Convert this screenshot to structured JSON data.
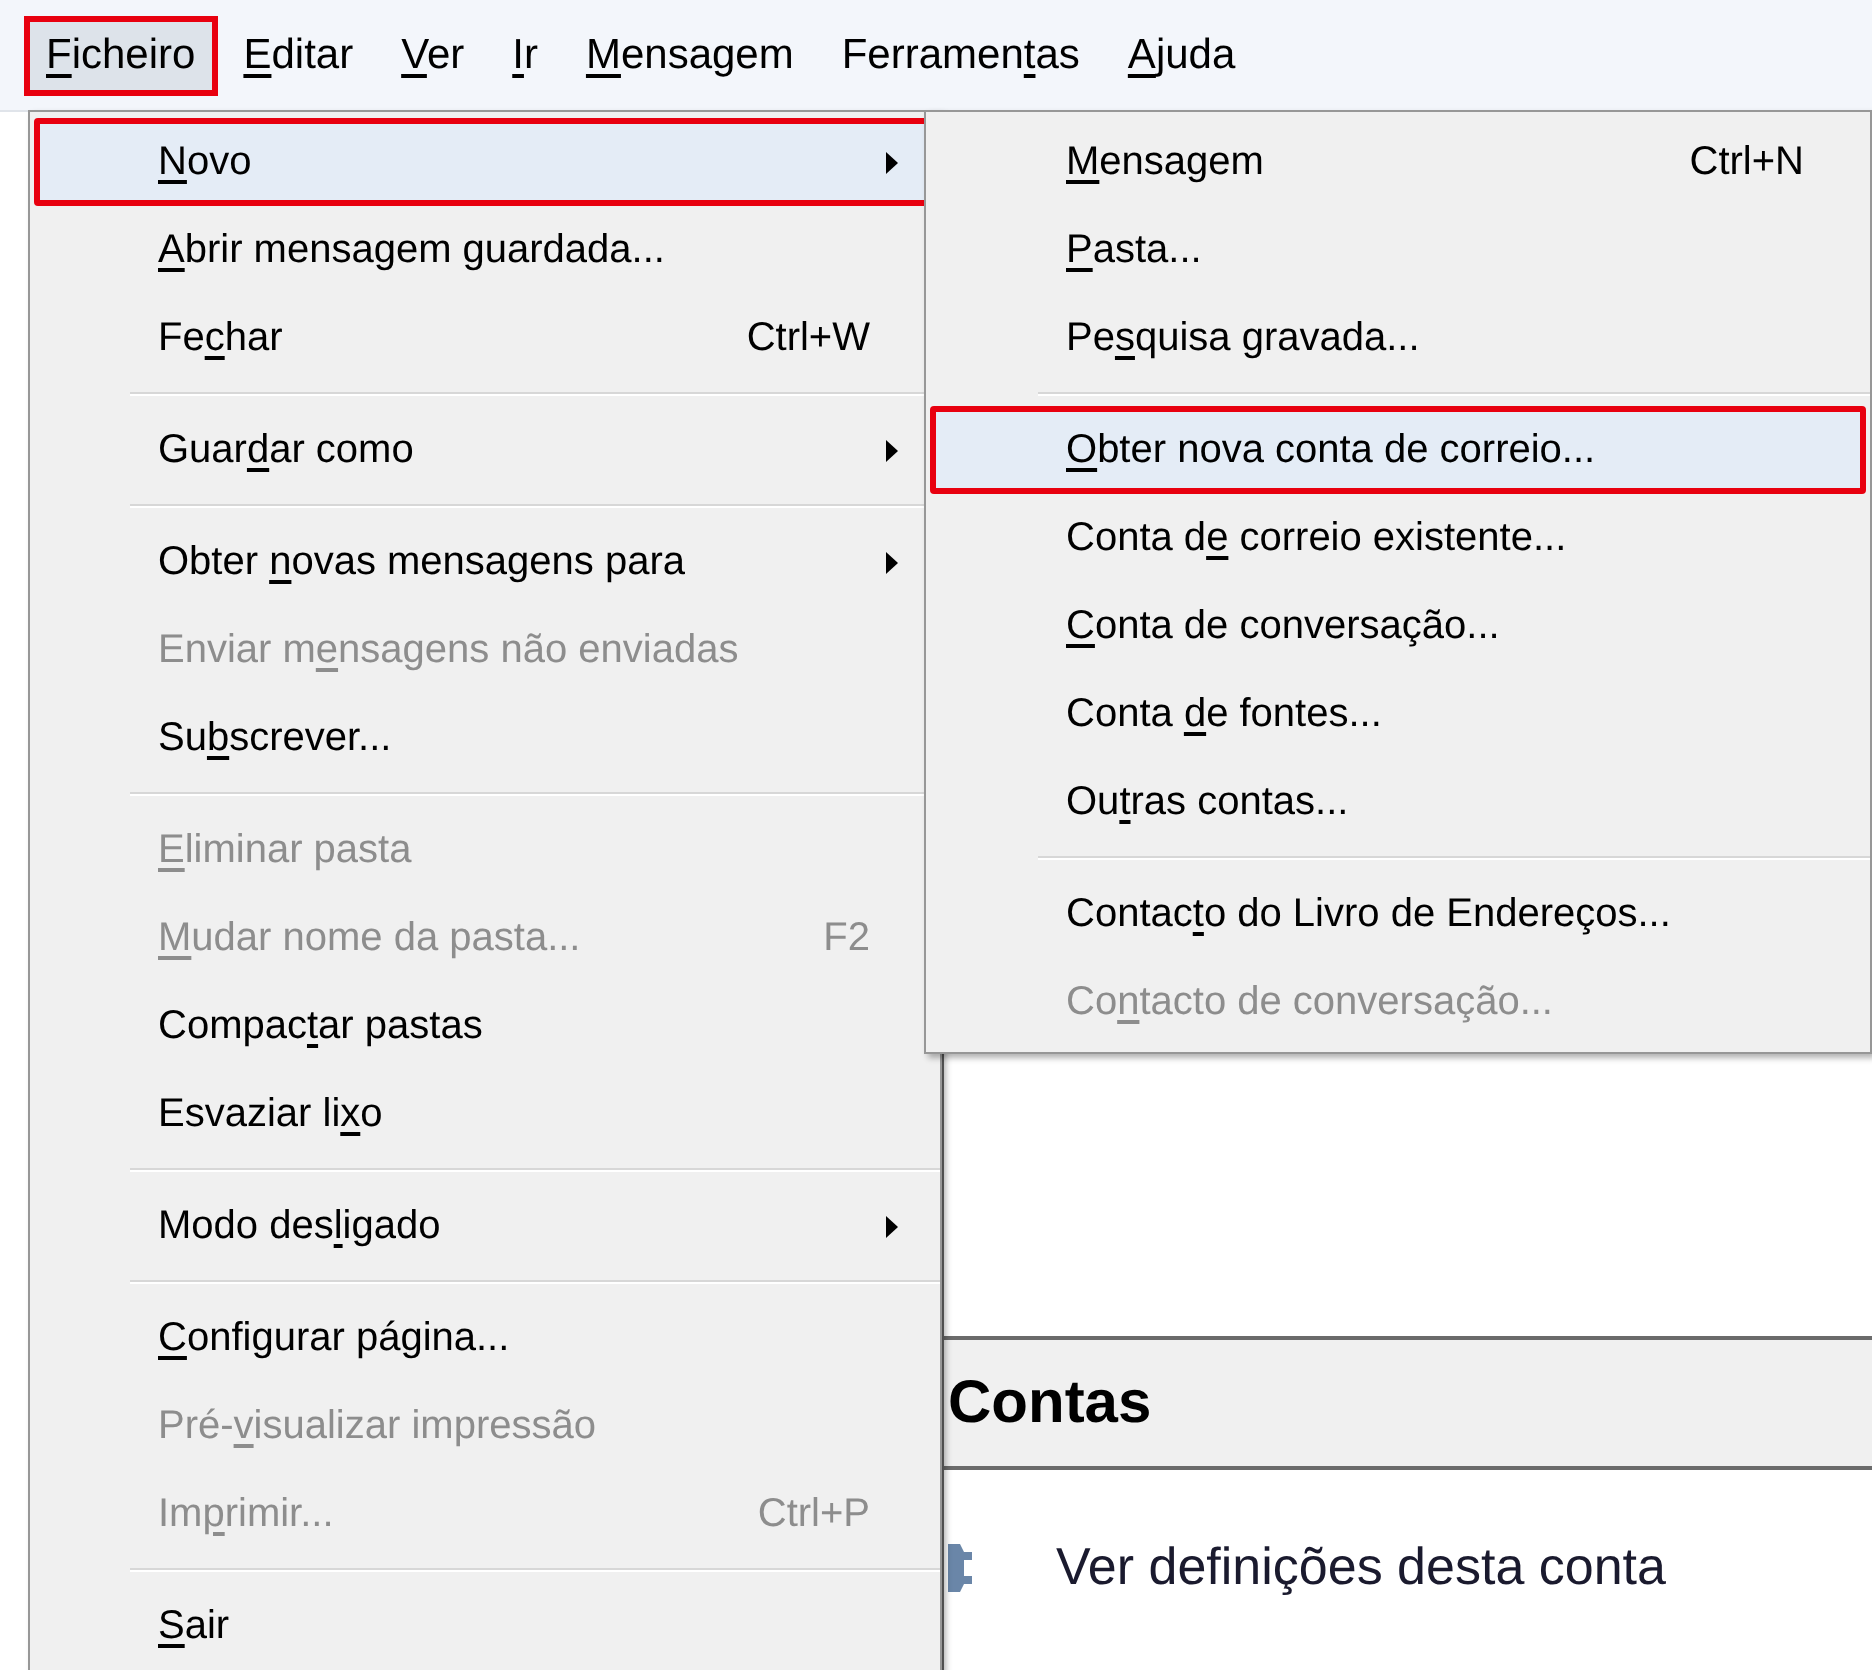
{
  "menu_bar": [
    {
      "label": {
        "key": "F",
        "post": "icheiro"
      },
      "selected": true,
      "highlighted": true
    },
    {
      "label": {
        "key": "E",
        "post": "ditar"
      },
      "selected": false,
      "highlighted": false
    },
    {
      "label": {
        "key": "V",
        "post": "er"
      },
      "selected": false,
      "highlighted": false
    },
    {
      "label": {
        "key": "I",
        "post": "r"
      },
      "selected": false,
      "highlighted": false
    },
    {
      "label": {
        "key": "M",
        "post": "ensagem"
      },
      "selected": false,
      "highlighted": false
    },
    {
      "label": {
        "pre": "Ferramen",
        "key": "t",
        "post": "as"
      },
      "selected": false,
      "highlighted": false
    },
    {
      "label": {
        "key": "A",
        "post": "juda"
      },
      "selected": false,
      "highlighted": false
    }
  ],
  "file_menu": [
    {
      "kind": "item",
      "label": {
        "key": "N",
        "post": "ovo"
      },
      "submenu": true,
      "disabled": false,
      "selected": true,
      "highlighted": true
    },
    {
      "kind": "item",
      "label": {
        "key": "A",
        "post": "brir mensagem guardada..."
      },
      "submenu": false,
      "disabled": false,
      "selected": false,
      "highlighted": false
    },
    {
      "kind": "item",
      "label": {
        "pre": "Fe",
        "key": "c",
        "post": "har"
      },
      "shortcut": "Ctrl+W",
      "submenu": false,
      "disabled": false,
      "selected": false,
      "highlighted": false
    },
    {
      "kind": "separator"
    },
    {
      "kind": "item",
      "label": {
        "pre": "Guar",
        "key": "d",
        "post": "ar como"
      },
      "submenu": true,
      "disabled": false,
      "selected": false,
      "highlighted": false
    },
    {
      "kind": "separator"
    },
    {
      "kind": "item",
      "label": {
        "pre": "Obter ",
        "key": "n",
        "post": "ovas mensagens para"
      },
      "submenu": true,
      "disabled": false,
      "selected": false,
      "highlighted": false
    },
    {
      "kind": "item",
      "label": {
        "pre": "Enviar m",
        "key": "e",
        "post": "nsagens não enviadas"
      },
      "submenu": false,
      "disabled": true,
      "selected": false,
      "highlighted": false
    },
    {
      "kind": "item",
      "label": {
        "pre": "Su",
        "key": "b",
        "post": "screver..."
      },
      "submenu": false,
      "disabled": false,
      "selected": false,
      "highlighted": false
    },
    {
      "kind": "separator"
    },
    {
      "kind": "item",
      "label": {
        "key": "E",
        "post": "liminar pasta"
      },
      "submenu": false,
      "disabled": true,
      "selected": false,
      "highlighted": false
    },
    {
      "kind": "item",
      "label": {
        "key": "M",
        "post": "udar nome da pasta..."
      },
      "shortcut": "F2",
      "submenu": false,
      "disabled": true,
      "selected": false,
      "highlighted": false
    },
    {
      "kind": "item",
      "label": {
        "pre": "Compac",
        "key": "t",
        "post": "ar pastas"
      },
      "submenu": false,
      "disabled": false,
      "selected": false,
      "highlighted": false
    },
    {
      "kind": "item",
      "label": {
        "pre": "Esvaziar li",
        "key": "x",
        "post": "o"
      },
      "submenu": false,
      "disabled": false,
      "selected": false,
      "highlighted": false
    },
    {
      "kind": "separator"
    },
    {
      "kind": "item",
      "label": {
        "pre": "Modo des",
        "key": "l",
        "post": "igado"
      },
      "submenu": true,
      "disabled": false,
      "selected": false,
      "highlighted": false
    },
    {
      "kind": "separator"
    },
    {
      "kind": "item",
      "label": {
        "key": "C",
        "post": "onfigurar página..."
      },
      "submenu": false,
      "disabled": false,
      "selected": false,
      "highlighted": false
    },
    {
      "kind": "item",
      "label": {
        "pre": "Pré-",
        "key": "v",
        "post": "isualizar impressão"
      },
      "submenu": false,
      "disabled": true,
      "selected": false,
      "highlighted": false
    },
    {
      "kind": "item",
      "label": {
        "pre": "Im",
        "key": "p",
        "post": "rimir..."
      },
      "shortcut": "Ctrl+P",
      "submenu": false,
      "disabled": true,
      "selected": false,
      "highlighted": false
    },
    {
      "kind": "separator"
    },
    {
      "kind": "item",
      "label": {
        "key": "S",
        "post": "air"
      },
      "submenu": false,
      "disabled": false,
      "selected": false,
      "highlighted": false
    }
  ],
  "new_submenu": [
    {
      "kind": "item",
      "label": {
        "key": "M",
        "post": "ensagem"
      },
      "shortcut": "Ctrl+N",
      "submenu": false,
      "disabled": false,
      "selected": false,
      "highlighted": false
    },
    {
      "kind": "item",
      "label": {
        "key": "P",
        "post": "asta..."
      },
      "submenu": false,
      "disabled": false,
      "selected": false,
      "highlighted": false
    },
    {
      "kind": "item",
      "label": {
        "pre": "Pe",
        "key": "s",
        "post": "quisa gravada..."
      },
      "submenu": false,
      "disabled": false,
      "selected": false,
      "highlighted": false
    },
    {
      "kind": "separator"
    },
    {
      "kind": "item",
      "label": {
        "key": "O",
        "post": "bter nova conta de correio..."
      },
      "submenu": false,
      "disabled": false,
      "selected": true,
      "highlighted": true
    },
    {
      "kind": "item",
      "label": {
        "pre": "Conta d",
        "key": "e",
        "post": " correio existente..."
      },
      "submenu": false,
      "disabled": false,
      "selected": false,
      "highlighted": false
    },
    {
      "kind": "item",
      "label": {
        "key": "C",
        "post": "onta de conversação..."
      },
      "submenu": false,
      "disabled": false,
      "selected": false,
      "highlighted": false
    },
    {
      "kind": "item",
      "label": {
        "pre": "Conta ",
        "key": "d",
        "post": "e fontes..."
      },
      "submenu": false,
      "disabled": false,
      "selected": false,
      "highlighted": false
    },
    {
      "kind": "item",
      "label": {
        "pre": "Ou",
        "key": "t",
        "post": "ras contas..."
      },
      "submenu": false,
      "disabled": false,
      "selected": false,
      "highlighted": false
    },
    {
      "kind": "separator"
    },
    {
      "kind": "item",
      "label": {
        "pre": "Contac",
        "key": "t",
        "post": "o do Livro de Endereços..."
      },
      "submenu": false,
      "disabled": false,
      "selected": false,
      "highlighted": false
    },
    {
      "kind": "item",
      "label": {
        "pre": "Co",
        "key": "n",
        "post": "tacto de conversação..."
      },
      "submenu": false,
      "disabled": true,
      "selected": false,
      "highlighted": false
    }
  ],
  "accounts_section": {
    "title": "Contas",
    "action": "Ver definições desta conta"
  }
}
